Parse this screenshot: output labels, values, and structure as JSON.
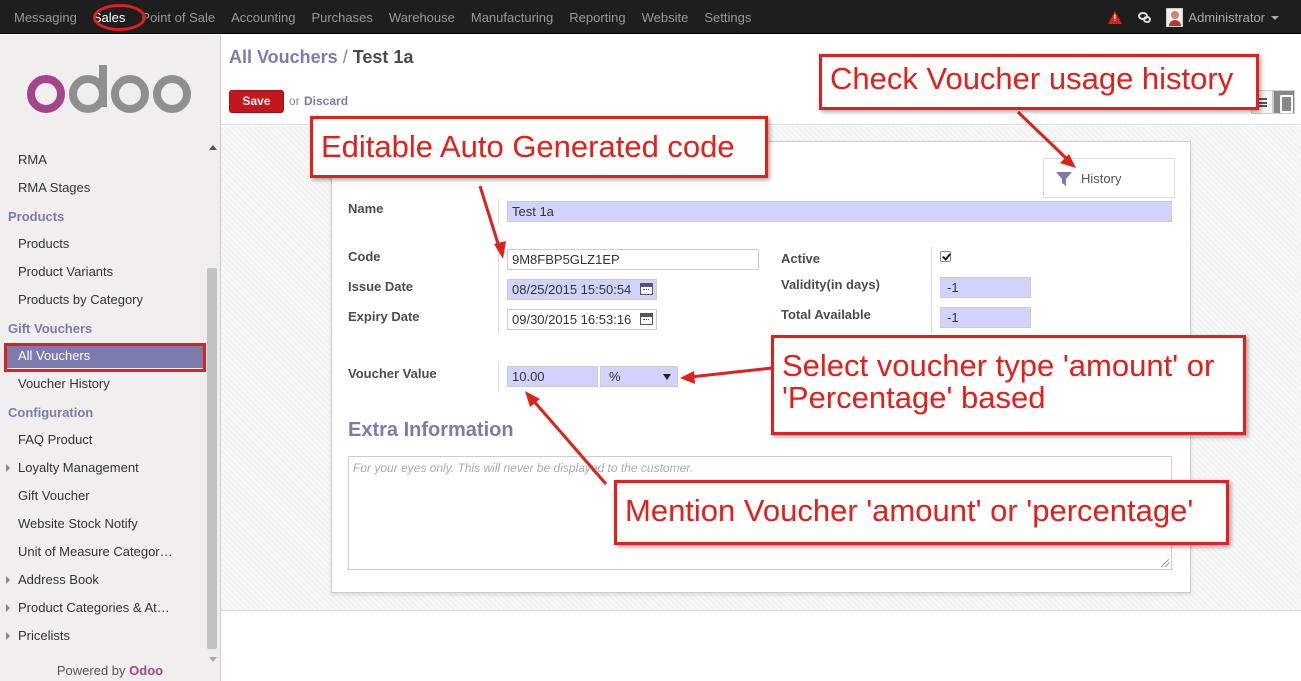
{
  "topbar": {
    "menu": [
      "Messaging",
      "Sales",
      "Point of Sale",
      "Accounting",
      "Purchases",
      "Warehouse",
      "Manufacturing",
      "Reporting",
      "Website",
      "Settings"
    ],
    "active_menu": "Sales",
    "user": "Administrator"
  },
  "sidebar": {
    "logo_text": "odoo",
    "items": [
      {
        "type": "item",
        "label": "RMA"
      },
      {
        "type": "item",
        "label": "RMA Stages"
      },
      {
        "type": "header",
        "label": "Products"
      },
      {
        "type": "item",
        "label": "Products"
      },
      {
        "type": "item",
        "label": "Product Variants"
      },
      {
        "type": "item",
        "label": "Products by Category"
      },
      {
        "type": "header",
        "label": "Gift Vouchers"
      },
      {
        "type": "item",
        "label": "All Vouchers",
        "selected": true
      },
      {
        "type": "item",
        "label": "Voucher History"
      },
      {
        "type": "header",
        "label": "Configuration"
      },
      {
        "type": "item",
        "label": "FAQ Product"
      },
      {
        "type": "item",
        "label": "Loyalty Management",
        "expandable": true
      },
      {
        "type": "item",
        "label": "Gift Voucher"
      },
      {
        "type": "item",
        "label": "Website Stock Notify"
      },
      {
        "type": "item",
        "label": "Unit of Measure Categor…"
      },
      {
        "type": "item",
        "label": "Address Book",
        "expandable": true
      },
      {
        "type": "item",
        "label": "Product Categories & At…",
        "expandable": true
      },
      {
        "type": "item",
        "label": "Pricelists",
        "expandable": true
      }
    ],
    "powered_prefix": "Powered by",
    "powered_brand": "Odoo"
  },
  "header": {
    "breadcrumb_parent": "All Vouchers",
    "breadcrumb_sep": "/",
    "breadcrumb_current": "Test 1a",
    "save_label": "Save",
    "or_label": "or",
    "discard_label": "Discard"
  },
  "form": {
    "history_label": "History",
    "name_label": "Name",
    "name_value": "Test 1a",
    "code_label": "Code",
    "code_value": "9M8FBP5GLZ1EP",
    "issue_label": "Issue Date",
    "issue_value": "08/25/2015 15:50:54",
    "expiry_label": "Expiry Date",
    "expiry_value": "09/30/2015 16:53:16",
    "active_label": "Active",
    "active_checked": true,
    "validity_label": "Validity(in days)",
    "validity_value": "-1",
    "total_label": "Total Available",
    "total_value": "-1",
    "voucher_value_label": "Voucher Value",
    "voucher_value": "10.00",
    "voucher_type": "%",
    "extra_title": "Extra Information",
    "notes_placeholder": "For your eyes only. This will never be displayed to the customer."
  },
  "annotations": {
    "history_note": "Check Voucher usage history",
    "code_note": "Editable Auto Generated code",
    "type_note_line1": "Select voucher type 'amount' or",
    "type_note_line2": "'Percentage' based",
    "value_note": "Mention Voucher 'amount' or 'percentage'"
  },
  "colors": {
    "accent": "#7c7bad",
    "annotation_red": "#e0201b",
    "save_red": "#c4161c",
    "input_bg": "#d2d2ff"
  }
}
